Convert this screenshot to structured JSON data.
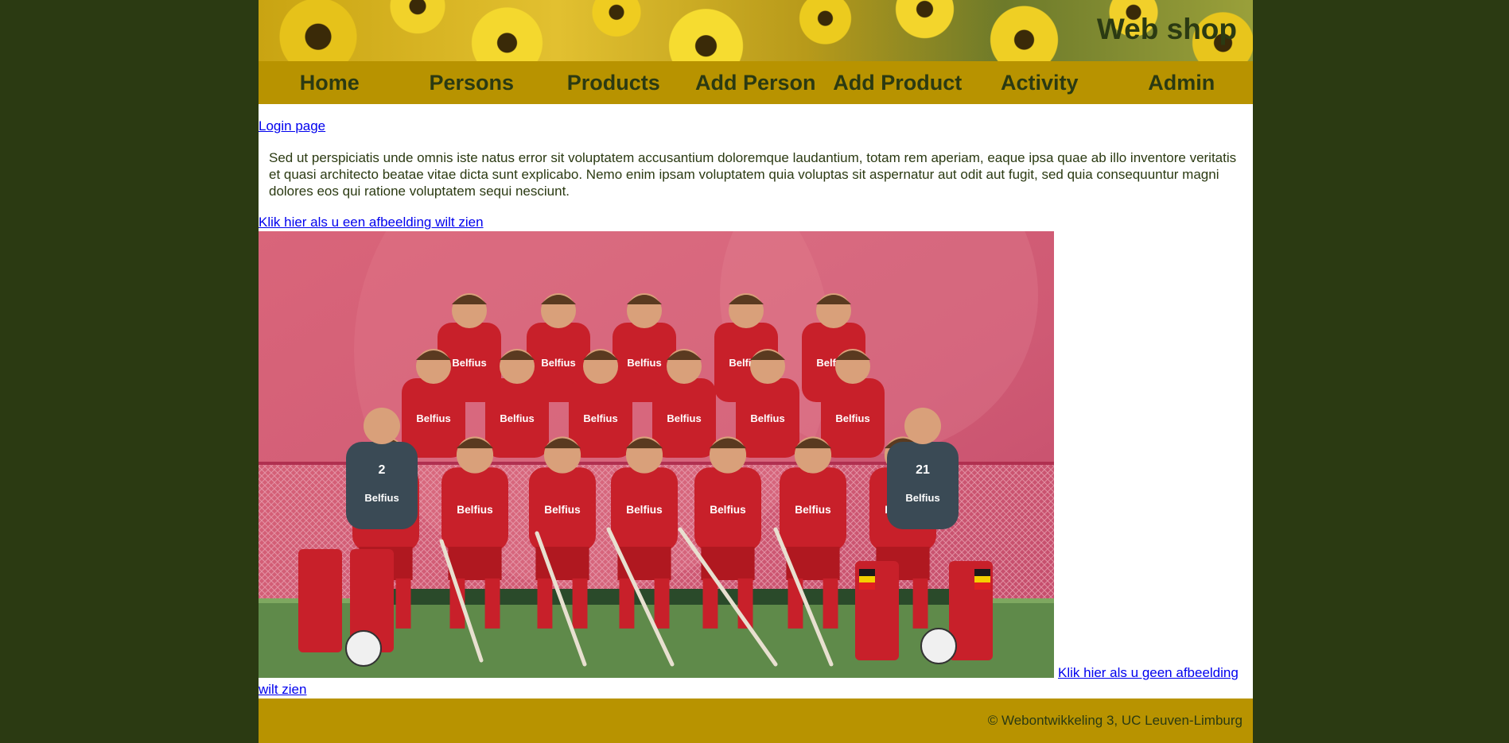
{
  "header": {
    "title": "Web shop",
    "banner_image": "sunflower-field-banner"
  },
  "nav": {
    "items": [
      {
        "label": "Home"
      },
      {
        "label": "Persons"
      },
      {
        "label": "Products"
      },
      {
        "label": "Add Person"
      },
      {
        "label": "Add Product"
      },
      {
        "label": "Activity"
      },
      {
        "label": "Admin"
      }
    ]
  },
  "main": {
    "login_link": "Login page",
    "intro_text": "Sed ut perspiciatis unde omnis iste natus error sit voluptatem accusantium doloremque laudantium, totam rem aperiam, eaque ipsa quae ab illo inventore veritatis et quasi architecto beatae vitae dicta sunt explicabo. Nemo enim ipsam voluptatem quia voluptas sit aspernatur aut odit aut fugit, sed quia consequuntur magni dolores eos qui ratione voluptatem sequi nesciunt.",
    "show_image_link": "Klik hier als u een afbeelding wilt zien",
    "image": {
      "subject": "belgian-hockey-team-photo",
      "shirt_text": "Belfius",
      "keeper_numbers": [
        "2",
        "21"
      ]
    },
    "hide_image_link_part1": "Klik hier als u geen afbeelding",
    "hide_image_link_part2": "wilt zien"
  },
  "footer": {
    "text": "© Webontwikkeling 3, UC Leuven-Limburg"
  },
  "colors": {
    "page_background": "#2b3a12",
    "nav_background": "#b89300",
    "text_dark": "#2b3a12",
    "link": "#0000ee",
    "jersey_red": "#c8202a",
    "keeper_jersey": "#3a4a55"
  }
}
